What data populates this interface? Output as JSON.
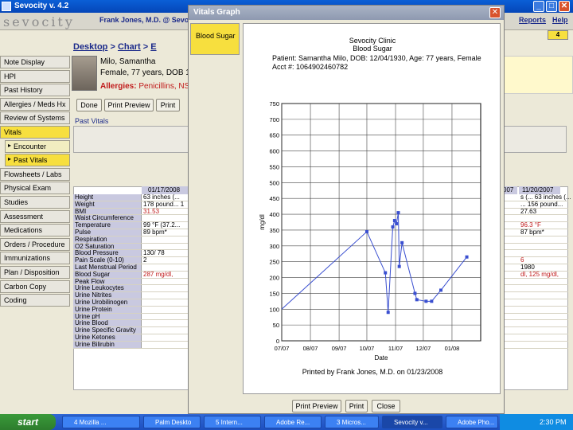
{
  "window": {
    "title": "Sevocity v. 4.2"
  },
  "header": {
    "logo": "sevocity",
    "user": "Frank Jones, M.D. @ Sevoc",
    "menus": [
      "Reports",
      "Help"
    ],
    "menu_partial": "s",
    "help_badge": "4"
  },
  "breadcrumb": [
    "Desktop",
    "Chart",
    "E"
  ],
  "nav": [
    {
      "label": "Note Display"
    },
    {
      "label": "HPI"
    },
    {
      "label": "Past History"
    },
    {
      "label": "Allergies / Meds Hx"
    },
    {
      "label": "Review of Systems"
    },
    {
      "label": "Vitals",
      "active": true
    },
    {
      "label": "Encounter",
      "sub": true
    },
    {
      "label": "Past Vitals",
      "sub": true,
      "active": true
    },
    {
      "label": "Flowsheets / Labs"
    },
    {
      "label": "Physical Exam"
    },
    {
      "label": "Studies"
    },
    {
      "label": "Assessment"
    },
    {
      "label": "Medications"
    },
    {
      "label": "Orders / Procedure"
    },
    {
      "label": "Immunizations"
    },
    {
      "label": "Plan / Disposition"
    },
    {
      "label": "Carbon Copy"
    },
    {
      "label": "Coding"
    }
  ],
  "patient": {
    "name": "Milo, Samantha",
    "demo": "Female, 77 years, DOB 1",
    "allergy_label": "Allergies:",
    "allergies": "Penicillins, NS"
  },
  "actions": {
    "done": "Done",
    "print_preview": "Print Preview",
    "print": "Print"
  },
  "past_vitals_label": "Past Vitals",
  "vitals": {
    "col1_header": "01/17/2008",
    "col2_header": "007",
    "col3_header": "11/20/2007",
    "rows": [
      {
        "label": "Height",
        "v1": "63 inches (...",
        "v2": "s (... 63 inches (..."
      },
      {
        "label": "Weight",
        "v1": "178 pound... 1",
        "v2": "... 156 pound..."
      },
      {
        "label": "BMI",
        "v1": "31.53",
        "v2": "27.63",
        "red": true
      },
      {
        "label": "Waist Circumference",
        "v1": "",
        "v2": ""
      },
      {
        "label": "Temperature",
        "v1": "99 °F (37.2...",
        "v2": "96.3 °F",
        "red2": true
      },
      {
        "label": "Pulse",
        "v1": "89 bpm*",
        "v2": "87 bpm*"
      },
      {
        "label": "Respiration",
        "v1": "",
        "v2": ""
      },
      {
        "label": "O2 Saturation",
        "v1": "",
        "v2": ""
      },
      {
        "label": "Blood Pressure",
        "v1": "130/ 78",
        "v2": ""
      },
      {
        "label": "Pain Scale (0-10)",
        "v1": "2",
        "v2": "6",
        "red2": true
      },
      {
        "label": "Last Menstrual Period",
        "v1": "",
        "v2": "1980"
      },
      {
        "label": "Blood Sugar",
        "v1": "287 mg/dl,",
        "v2": "dl, 125 mg/dl,",
        "red": true,
        "red2": true
      },
      {
        "label": "Peak Flow",
        "v1": "",
        "v2": ""
      },
      {
        "label": "Urine Leukocytes",
        "v1": "",
        "v2": ""
      },
      {
        "label": "Urine Nitrites",
        "v1": "",
        "v2": ""
      },
      {
        "label": "Urine Urobilinogen",
        "v1": "",
        "v2": ""
      },
      {
        "label": "Urine Protein",
        "v1": "",
        "v2": ""
      },
      {
        "label": "Urine pH",
        "v1": "",
        "v2": ""
      },
      {
        "label": "Urine Blood",
        "v1": "",
        "v2": ""
      },
      {
        "label": "Urine Specific Gravity",
        "v1": "",
        "v2": ""
      },
      {
        "label": "Urine Ketones",
        "v1": "",
        "v2": ""
      },
      {
        "label": "Urine Bilirubin",
        "v1": "",
        "v2": ""
      }
    ]
  },
  "dialog": {
    "title": "Vitals Graph",
    "tab": "Blood Sugar",
    "clinic": "Sevocity Clinic",
    "subtitle": "Blood Sugar",
    "patient_line": "Patient: Samantha Milo, DOB: 12/04/1930, Age: 77 years, Female",
    "acct_line": "Acct #: 1064902460782",
    "footer": "Printed by Frank Jones, M.D. on 01/23/2008",
    "buttons": {
      "print_preview": "Print Preview",
      "print": "Print",
      "close": "Close"
    }
  },
  "chart_data": {
    "type": "line",
    "ylabel": "mg/dl",
    "xlabel": "Date",
    "ylim": [
      0,
      750
    ],
    "yticks": [
      0,
      50,
      100,
      150,
      200,
      250,
      300,
      350,
      400,
      450,
      500,
      550,
      600,
      650,
      700,
      750
    ],
    "x_ticks": [
      "07/07",
      "08/07",
      "09/07",
      "10/07",
      "11/07",
      "12/07",
      "01/08"
    ],
    "grid": true,
    "series": [
      {
        "color": "#3a4fd0",
        "points": [
          [
            "2007-07-01",
            100
          ],
          [
            "2007-10-01",
            345
          ],
          [
            "2007-10-21",
            215
          ],
          [
            "2007-10-24",
            90
          ],
          [
            "2007-10-29",
            360
          ],
          [
            "2007-10-31",
            380
          ],
          [
            "2007-11-02",
            370
          ],
          [
            "2007-11-04",
            405
          ],
          [
            "2007-11-05",
            235
          ],
          [
            "2007-11-08",
            310
          ],
          [
            "2007-11-22",
            150
          ],
          [
            "2007-11-24",
            130
          ],
          [
            "2007-12-04",
            125
          ],
          [
            "2007-12-10",
            125
          ],
          [
            "2007-12-20",
            160
          ],
          [
            "2008-01-17",
            265
          ]
        ]
      }
    ]
  },
  "taskbar": {
    "start": "start",
    "tasks": [
      "4 Mozilla ...",
      "Palm Deskto",
      "5 Intern...",
      "Adobe Re...",
      "3 Micros...",
      "Sevocity v...",
      "Adobe Pho..."
    ],
    "clock": "2:30 PM"
  }
}
